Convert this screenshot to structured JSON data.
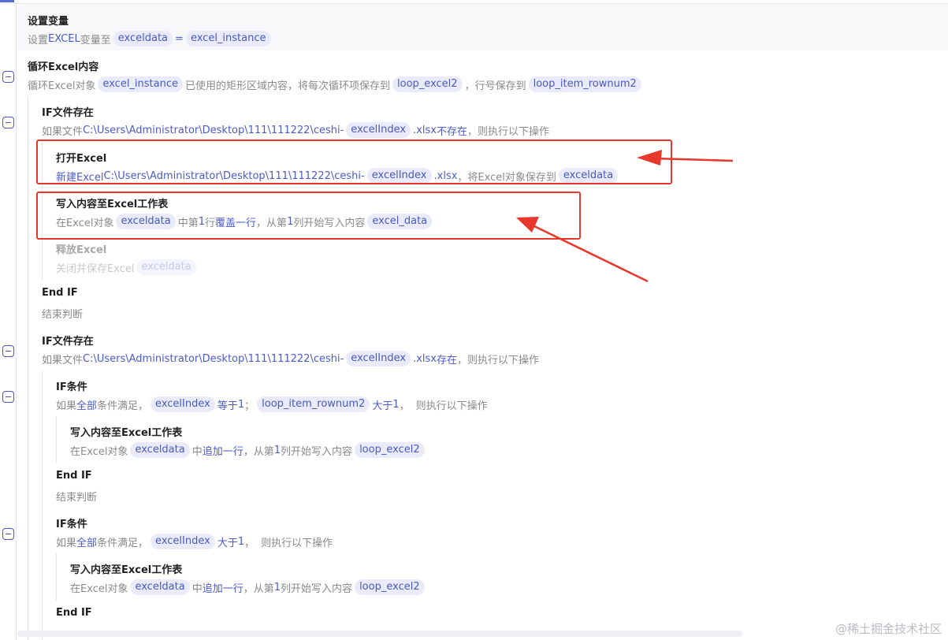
{
  "colors": {
    "accent": "#4c5bc9",
    "chip_bg": "#e9ebfb",
    "annotation_red": "#e8372b"
  },
  "steps": {
    "set_var": {
      "title": "设置变量",
      "d1": "设置",
      "d2": "EXCEL",
      "d3": "变量至",
      "v1": "exceldata",
      "d4": "=",
      "v2": "excel_instance"
    },
    "loop": {
      "title": "循环Excel内容",
      "d1": "循环Excel对象",
      "v1": "excel_instance",
      "d2": "已使用的矩形区域内容，将每次循环项保存到",
      "v2": "loop_excel2",
      "d3": "，行号保存到",
      "v3": "loop_item_rownum2"
    },
    "if1": {
      "title": "IF文件存在",
      "d1": "如果文件",
      "d2": "C:\\Users\\Administrator\\Desktop\\111\\111222\\ceshi-",
      "v1": "excelIndex",
      "d3": ".xlsx",
      "d4": "不存在",
      "d5": "，则执行以下操作"
    },
    "open_excel": {
      "title": "打开Excel",
      "d1": "新建Excel",
      "d2": "C:\\Users\\Administrator\\Desktop\\111\\111222\\ceshi-",
      "v1": "excelIndex",
      "d3": ".xlsx",
      "d4": "，将Excel对象保存到",
      "v2": "exceldata"
    },
    "write1": {
      "title": "写入内容至Excel工作表",
      "d1": "在Excel对象",
      "v1": "exceldata",
      "d2": "中第",
      "d3": "1",
      "d4": "行",
      "d5": "覆盖一行",
      "d6": "，从第",
      "d7": "1",
      "d8": "列开始写入内容",
      "v2": "excel_data"
    },
    "release": {
      "title": "释放Excel",
      "d1": "关闭并保存Excel",
      "v1": "exceldata"
    },
    "endif1": {
      "title": "End IF",
      "desc": "结束判断"
    },
    "if2": {
      "title": "IF文件存在",
      "d1": "如果文件",
      "d2": "C:\\Users\\Administrator\\Desktop\\111\\111222\\ceshi-",
      "v1": "excelIndex",
      "d3": ".xlsx",
      "d4": "存在",
      "d5": "，则执行以下操作"
    },
    "ifcond1": {
      "title": "IF条件",
      "d1": "如果",
      "d2": "全部",
      "d3": "条件满足，",
      "v1": "excelIndex",
      "d4": "等于",
      "d5": "1",
      "d6": "；",
      "v2": "loop_item_rownum2",
      "d7": "大于",
      "d8": "1",
      "d9": "，",
      "d10": "则执行以下操作"
    },
    "write2": {
      "title": "写入内容至Excel工作表",
      "d1": "在Excel对象",
      "v1": "exceldata",
      "d2": "中",
      "d3": "追加一行",
      "d4": "，从第",
      "d5": "1",
      "d6": "列开始写入内容",
      "v2": "loop_excel2"
    },
    "endif2": {
      "title": "End IF",
      "desc": "结束判断"
    },
    "ifcond2": {
      "title": "IF条件",
      "d1": "如果",
      "d2": "全部",
      "d3": "条件满足，",
      "v1": "excelIndex",
      "d4": "大于",
      "d5": "1",
      "d6": "，",
      "d7": "则执行以下操作"
    },
    "write3": {
      "title": "写入内容至Excel工作表",
      "d1": "在Excel对象",
      "v1": "exceldata",
      "d2": "中",
      "d3": "追加一行",
      "d4": "，从第",
      "d5": "1",
      "d6": "列开始写入内容",
      "v2": "loop_excel2"
    },
    "endif3": {
      "title": "End IF"
    }
  },
  "watermark": "@稀土掘金技术社区"
}
